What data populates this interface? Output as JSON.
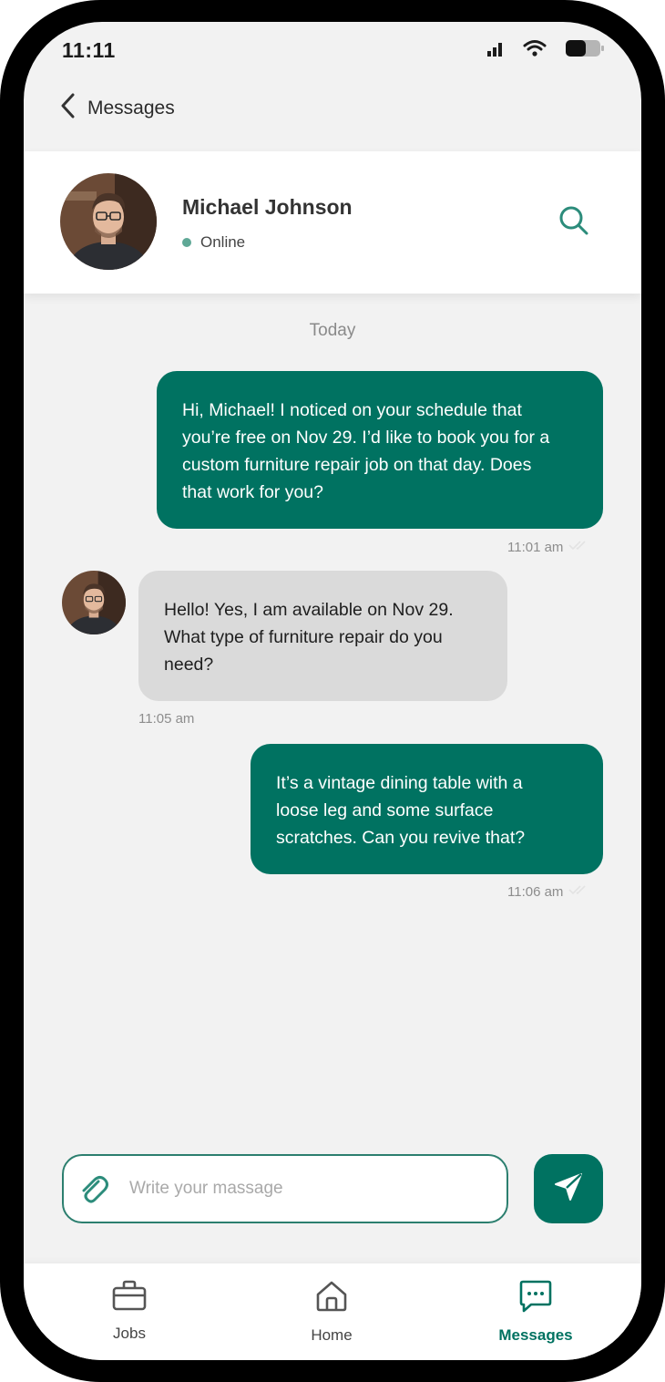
{
  "status_bar": {
    "time": "11:11"
  },
  "nav": {
    "back_label": "Messages"
  },
  "contact": {
    "name": "Michael Johnson",
    "status": "Online"
  },
  "chat": {
    "day_label": "Today",
    "messages": [
      {
        "direction": "outgoing",
        "text": "Hi, Michael! I noticed on your schedule that\nyou’re free on Nov 29. I’d like to book you for a\ncustom furniture repair job on that day. Does\nthat work for you?",
        "time": "11:01 am"
      },
      {
        "direction": "incoming",
        "text": "Hello! Yes, I am available on Nov 29.\nWhat type of furniture repair do you\nneed?",
        "time": "11:05 am"
      },
      {
        "direction": "outgoing",
        "text": "It’s a vintage dining table with a\nloose leg and some surface\nscratches. Can you revive that?",
        "time": "11:06 am"
      }
    ]
  },
  "composer": {
    "placeholder": "Write your massage"
  },
  "bottom_nav": {
    "tabs": [
      {
        "label": "Jobs",
        "icon": "briefcase-icon",
        "active": false
      },
      {
        "label": "Home",
        "icon": "home-icon",
        "active": false
      },
      {
        "label": "Messages",
        "icon": "chat-icon",
        "active": true
      }
    ]
  },
  "colors": {
    "accent": "#007261",
    "incoming_bubble": "#dadada",
    "online": "#5fa896",
    "background": "#f2f2f2"
  }
}
